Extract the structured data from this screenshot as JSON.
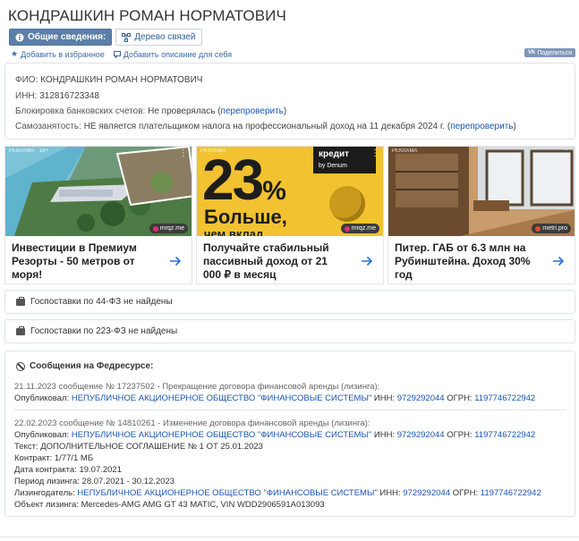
{
  "page_title": "КОНДРАШКИН РОМАН НОРМАТОВИЧ",
  "tabs": [
    {
      "label": "Общие сведения:",
      "active": true,
      "icon": "info-icon"
    },
    {
      "label": "Дерево связей",
      "active": false,
      "icon": "tree-icon"
    }
  ],
  "subactions": {
    "favorite": "Добавить в избранное",
    "description": "Добавить описание для себя"
  },
  "share_label": "Поделиться",
  "info": {
    "fio_label": "ФИО:",
    "fio_value": "КОНДРАШКИН РОМАН НОРМАТОВИЧ",
    "inn_label": "ИНН:",
    "inn_value": "312816723348",
    "block_label": "Блокировка банковских счетов:",
    "block_value": "Не проверялась",
    "block_link": "перепроверить",
    "self_label": "Самозанятость:",
    "self_value": "НЕ является плательщиком налога на профессиональный доход на 11 декабря 2024 г.",
    "self_link": "перепроверить"
  },
  "ads": [
    {
      "label": "РЕКЛАМА · 16+",
      "text": "Инвестиции в Премиум Резорты - 50 метров от моря!",
      "badge": "mrqz.me"
    },
    {
      "label": "РЕКЛАМА",
      "text": "Получайте стабильный пассивный доход от 21 000 ₽ в месяц",
      "badge": "mrqz.me",
      "big": "23",
      "pct": "%",
      "sub": "Больше,",
      "sub2": "чем вклад",
      "brand": "кредит",
      "brand2": "by Denum"
    },
    {
      "label": "РЕКЛАМА",
      "text": "Питер. ГАБ от 6.3 млн на Рубинштейна. Доход 30% год",
      "badge": "metri.pro"
    }
  ],
  "gos44": "Госпоставки по 44-ФЗ не найдены",
  "gos223": "Госпоставки по 223-ФЗ не найдены",
  "fedresurs": {
    "title": "Сообщения на Федресурсе:",
    "messages": [
      {
        "header": "21.11.2023 сообщение № 17237502 - Прекращение договора финансовой аренды (лизинга):",
        "published_label": "Опубликовал:",
        "org": "НЕПУБЛИЧНОЕ АКЦИОНЕРНОЕ ОБЩЕСТВО \"ФИНАНСОВЫЕ СИСТЕМЫ\"",
        "inn_label": "ИНН:",
        "inn": "9729292044",
        "ogrn_label": "ОГРН:",
        "ogrn": "1197746722942"
      },
      {
        "header": "22.02.2023 сообщение № 14810261 - Изменение договора финансовой аренды (лизинга):",
        "published_label": "Опубликовал:",
        "org": "НЕПУБЛИЧНОЕ АКЦИОНЕРНОЕ ОБЩЕСТВО \"ФИНАНСОВЫЕ СИСТЕМЫ\"",
        "inn_label": "ИНН:",
        "inn": "9729292044",
        "ogrn_label": "ОГРН:",
        "ogrn": "1197746722942",
        "text": "Текст: ДОПОЛНИТЕЛЬНОЕ СОГЛАШЕНИЕ № 1 ОТ 25.01.2023",
        "contract": "Контракт: 1/77/1 МБ",
        "contract_date": "Дата контракта: 19.07.2021",
        "period": "Период лизинга: 28.07.2021 - 30.12.2023",
        "lessor_label": "Лизингодатель:",
        "object": "Объект лизинга: Mercedes-AMG AMG GT 43 MATIC, VIN WDD2906591A013093"
      }
    ]
  },
  "colors": {
    "active_tab": "#5b7fa8",
    "link": "#1a56b0",
    "share": "#7e97b8",
    "arrow": "#2b6fd6"
  }
}
